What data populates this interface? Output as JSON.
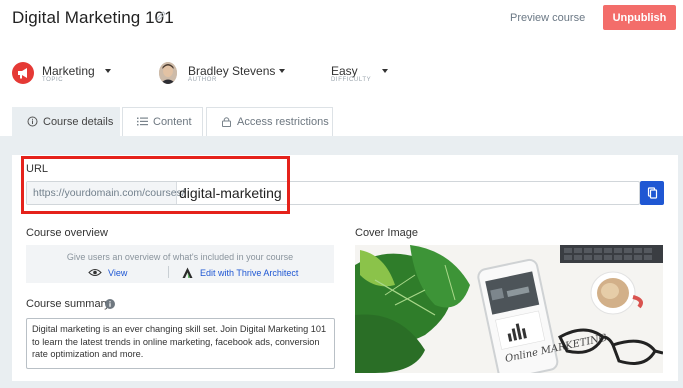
{
  "header": {
    "course_title": "Digital Marketing 101",
    "preview_label": "Preview course",
    "unpublish_label": "Unpublish"
  },
  "meta": {
    "topic": {
      "value": "Marketing",
      "label": "TOPIC",
      "icon": "megaphone-icon",
      "icon_color": "#e53935"
    },
    "author": {
      "value": "Bradley Stevens",
      "label": "AUTHOR",
      "icon": "avatar"
    },
    "difficulty": {
      "value": "Easy",
      "label": "DIFFICULTY"
    }
  },
  "tabs": [
    {
      "label": "Course details",
      "icon": "info-icon",
      "active": true
    },
    {
      "label": "Content",
      "icon": "list-icon",
      "active": false
    },
    {
      "label": "Access restrictions",
      "icon": "lock-icon",
      "active": false
    }
  ],
  "url": {
    "label": "URL",
    "prefix": "https://yourdomain.com/courses/",
    "slug": "digital-marketing",
    "copy_icon": "copy-icon"
  },
  "overview": {
    "label": "Course overview",
    "hint": "Give users an overview of what's included in your course",
    "view_label": "View",
    "edit_label": "Edit with Thrive Architect"
  },
  "summary": {
    "label": "Course summary",
    "text": "Digital marketing is an ever changing skill set. Join Digital Marketing 101 to learn the latest trends in online marketing, facebook ads, conversion rate optimization and more."
  },
  "cover": {
    "label": "Cover Image",
    "phone_text": "Online MARKETING"
  },
  "colors": {
    "accent": "#1f57d3",
    "unpublish": "#f36d6a",
    "highlight": "#e5221b",
    "panel_bg": "#e9eef1"
  }
}
